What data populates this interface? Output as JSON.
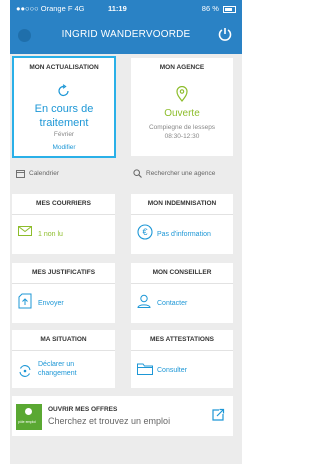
{
  "status_bar": {
    "carrier": "●●○○○ Orange F  4G",
    "time": "11:19",
    "battery": "86 %"
  },
  "header": {
    "title": "INGRID WANDERVOORDE"
  },
  "actualisation": {
    "title": "MON ACTUALISATION",
    "status": "En cours de traitement",
    "month": "Février",
    "action": "Modifier"
  },
  "agence": {
    "title": "MON AGENCE",
    "status": "Ouverte",
    "name": "Compiegne de lesseps",
    "hours": "08:30-12:30"
  },
  "links": {
    "calendar": "Calendrier",
    "search_agency": "Rechercher une agence"
  },
  "tiles": [
    {
      "title": "MES COURRIERS",
      "text": "1 non lu",
      "icon": "mail-icon"
    },
    {
      "title": "MON INDEMNISATION",
      "text": "Pas d'information",
      "icon": "euro-icon"
    },
    {
      "title": "MES JUSTIFICATIFS",
      "text": "Envoyer",
      "icon": "upload-icon"
    },
    {
      "title": "MON CONSEILLER",
      "text": "Contacter",
      "icon": "person-icon"
    },
    {
      "title": "MA SITUATION",
      "text": "Déclarer un changement",
      "icon": "cycle-icon"
    },
    {
      "title": "MES ATTESTATIONS",
      "text": "Consulter",
      "icon": "folder-icon"
    }
  ],
  "offres": {
    "title": "OUVRIR MES OFFRES",
    "subtitle": "Cherchez et trouvez un emploi",
    "logo_text": "pôle emploi"
  },
  "colors": {
    "primary": "#2a82c5",
    "accent": "#1d97d6",
    "success": "#8dbd2b",
    "highlight": "#2ab0e8"
  }
}
